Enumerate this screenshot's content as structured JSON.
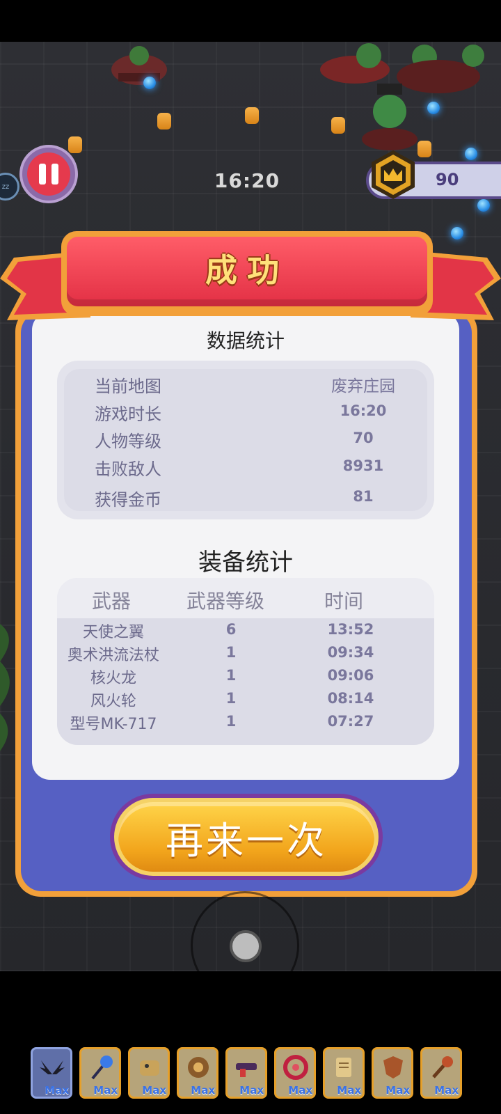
{
  "hud": {
    "timer": "16:20",
    "coins": "90",
    "side_badge": "zz"
  },
  "result": {
    "title": "成功"
  },
  "stats": {
    "title": "数据统计",
    "rows": [
      {
        "label": "当前地图",
        "value": "废弃庄园"
      },
      {
        "label": "游戏时长",
        "value": "16:20"
      },
      {
        "label": "人物等级",
        "value": "70"
      },
      {
        "label": "击败敌人",
        "value": "8931"
      },
      {
        "label": "获得金币",
        "value": "81"
      }
    ]
  },
  "equipment": {
    "title": "装备统计",
    "headers": [
      "武器",
      "武器等级",
      "时间"
    ],
    "rows": [
      {
        "weapon": "天使之翼",
        "level": "6",
        "time": "13:52"
      },
      {
        "weapon": "奥术洪流法杖",
        "level": "1",
        "time": "09:34"
      },
      {
        "weapon": "核火龙",
        "level": "1",
        "time": "09:06"
      },
      {
        "weapon": "风火轮",
        "level": "1",
        "time": "08:14"
      },
      {
        "weapon": "型号MK-717",
        "level": "1",
        "time": "07:27"
      }
    ]
  },
  "retry_button": "再来一次",
  "weapon_bar": {
    "max_label": "Max",
    "slots": [
      {
        "icon": "wings-icon"
      },
      {
        "icon": "staff-icon"
      },
      {
        "icon": "dragon-icon"
      },
      {
        "icon": "wheel-icon"
      },
      {
        "icon": "gun-icon"
      },
      {
        "icon": "ring-icon"
      },
      {
        "icon": "scroll-icon"
      },
      {
        "icon": "shield-icon"
      },
      {
        "icon": "club-icon"
      }
    ]
  },
  "colors": {
    "panel_border": "#f2a03a",
    "panel_blue": "#5660c3",
    "banner_red": "#e22f44",
    "retry_gold": "#f2a51c"
  }
}
